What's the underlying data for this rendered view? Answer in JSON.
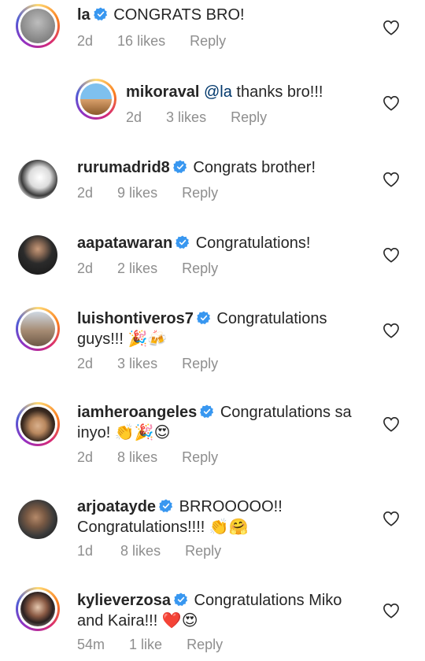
{
  "comments": [
    {
      "username": "la",
      "text": "CONGRATS BRO!",
      "age": "2d",
      "likes": "16 likes",
      "reply": "Reply",
      "line2": ""
    },
    {
      "username": "mikoraval",
      "mention": "@la",
      "text": "thanks bro!!!",
      "age": "2d",
      "likes": "3 likes",
      "reply": "Reply",
      "line2": ""
    },
    {
      "username": "rurumadrid8",
      "text": "Congrats brother!",
      "age": "2d",
      "likes": "9 likes",
      "reply": "Reply",
      "line2": ""
    },
    {
      "username": "aapatawaran",
      "text": "Congratulations!",
      "age": "2d",
      "likes": "2 likes",
      "reply": "Reply",
      "line2": ""
    },
    {
      "username": "luishontiveros7",
      "text": "Congratulations",
      "line2": "guys!!! 🎉🍻",
      "age": "2d",
      "likes": "3 likes",
      "reply": "Reply"
    },
    {
      "username": "iamheroangeles",
      "text": "Congratulations sa",
      "line2": "inyo! 👏🎉😍",
      "age": "2d",
      "likes": "8 likes",
      "reply": "Reply"
    },
    {
      "username": "arjoatayde",
      "text": "BRROOOOO!!",
      "line2": "Congratulations!!!! 👏🤗",
      "age": "1d",
      "likes": "8 likes",
      "reply": "Reply"
    },
    {
      "username": "kylieverzosa",
      "text": "Congratulations Miko",
      "line2": "and Kaira!!! ❤️😍",
      "age": "54m",
      "likes": "1 like",
      "reply": "Reply"
    }
  ],
  "colors": {
    "verified": "#3897f0",
    "meta": "#8e8e8e",
    "text": "#262626",
    "mention": "#00376b"
  },
  "icons": {
    "verified": "verified-badge-icon",
    "like": "heart-outline-icon"
  }
}
